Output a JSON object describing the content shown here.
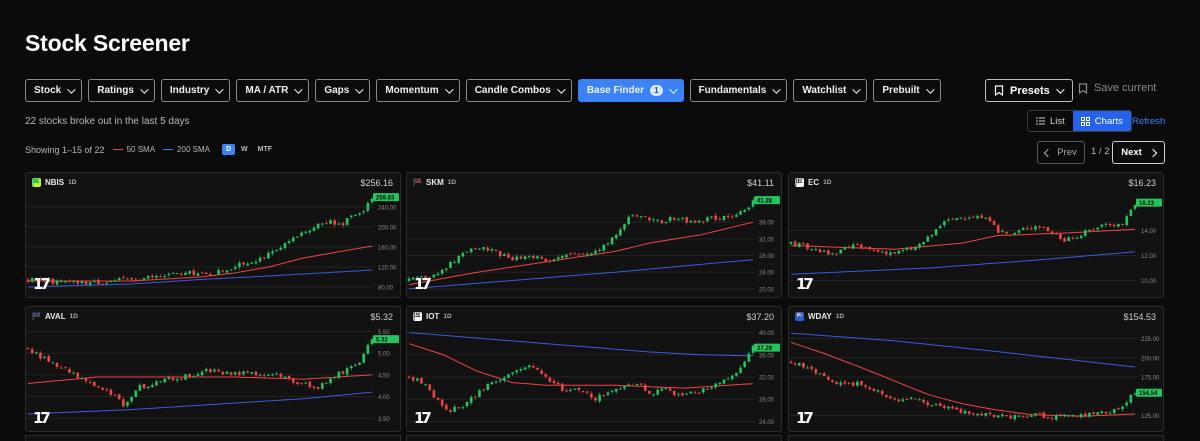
{
  "title": "Stock Screener",
  "filters": [
    {
      "label": "Stock",
      "active": false
    },
    {
      "label": "Ratings",
      "active": false
    },
    {
      "label": "Industry",
      "active": false
    },
    {
      "label": "MA / ATR",
      "active": false
    },
    {
      "label": "Gaps",
      "active": false
    },
    {
      "label": "Momentum",
      "active": false
    },
    {
      "label": "Candle Combos",
      "active": false
    },
    {
      "label": "Base Finder",
      "active": true,
      "badge": "1"
    },
    {
      "label": "Fundamentals",
      "active": false
    },
    {
      "label": "Watchlist",
      "active": false
    },
    {
      "label": "Prebuilt",
      "active": false
    }
  ],
  "presets_label": "Presets",
  "save_current_label": "Save current",
  "summary": "22 stocks broke out in the last 5 days",
  "view_list": "List",
  "view_charts": "Charts",
  "refresh": "Refresh",
  "showing": "Showing 1–15 of 22",
  "legend": [
    {
      "label": "50 SMA",
      "color": "#ef4444"
    },
    {
      "label": "200 SMA",
      "color": "#3b82f6"
    }
  ],
  "timeframes": [
    "D",
    "W",
    "MTF"
  ],
  "timeframe_active": "D",
  "pagination": {
    "prev": "Prev",
    "page": "1 / 2",
    "next": "Next"
  },
  "colors": {
    "up": "#22c55e",
    "down": "#ef4444",
    "accent": "#3b82f6",
    "sma50": "#ef4444",
    "sma200": "#3b5bdb"
  },
  "cards": [
    {
      "ticker": "NBIS",
      "tf": "1D",
      "price": "$256.16",
      "last_label": "259.83",
      "flag": "green",
      "logo": "N",
      "logo_bg": "#c6f432",
      "logo_fg": "#111",
      "ticks": [
        "240.00",
        "200.00",
        "160.00",
        "120.00",
        "80.00"
      ],
      "tick_values": [
        240,
        200,
        160,
        120,
        80
      ],
      "range": [
        68,
        268
      ],
      "last": 259.83,
      "path": [
        [
          0,
          95
        ],
        [
          0.08,
          90
        ],
        [
          0.16,
          88
        ],
        [
          0.24,
          92
        ],
        [
          0.3,
          96
        ],
        [
          0.36,
          100
        ],
        [
          0.42,
          105
        ],
        [
          0.48,
          108
        ],
        [
          0.52,
          104
        ],
        [
          0.56,
          112
        ],
        [
          0.62,
          125
        ],
        [
          0.68,
          140
        ],
        [
          0.72,
          150
        ],
        [
          0.76,
          170
        ],
        [
          0.8,
          190
        ],
        [
          0.84,
          205
        ],
        [
          0.88,
          215
        ],
        [
          0.91,
          200
        ],
        [
          0.94,
          225
        ],
        [
          0.97,
          230
        ],
        [
          1.0,
          259
        ]
      ],
      "sma50": [
        [
          0,
          92
        ],
        [
          0.3,
          92
        ],
        [
          0.5,
          100
        ],
        [
          0.6,
          108
        ],
        [
          0.7,
          120
        ],
        [
          0.8,
          138
        ],
        [
          0.9,
          150
        ],
        [
          1.0,
          162
        ]
      ],
      "sma200": [
        [
          0,
          80
        ],
        [
          0.3,
          86
        ],
        [
          0.5,
          95
        ],
        [
          0.7,
          102
        ],
        [
          0.85,
          108
        ],
        [
          1.0,
          114
        ]
      ]
    },
    {
      "ticker": "SKM",
      "tf": "1D",
      "price": "$41.11",
      "last_label": "41.28",
      "flag": "grey",
      "logo": "SK",
      "logo_bg": "#121212",
      "logo_fg": "#ef4444",
      "ticks": [
        "36.00",
        "32.00",
        "28.00",
        "24.00",
        "20.00"
      ],
      "tick_values": [
        36,
        32,
        28,
        24,
        20
      ],
      "range": [
        19,
        43
      ],
      "last": 41.28,
      "path": [
        [
          0,
          22
        ],
        [
          0.06,
          23
        ],
        [
          0.12,
          26
        ],
        [
          0.16,
          29
        ],
        [
          0.2,
          30
        ],
        [
          0.24,
          29
        ],
        [
          0.3,
          27
        ],
        [
          0.36,
          28
        ],
        [
          0.4,
          27
        ],
        [
          0.46,
          28
        ],
        [
          0.52,
          28.5
        ],
        [
          0.56,
          30
        ],
        [
          0.6,
          33
        ],
        [
          0.64,
          37
        ],
        [
          0.68,
          38
        ],
        [
          0.72,
          36
        ],
        [
          0.78,
          37
        ],
        [
          0.82,
          36
        ],
        [
          0.88,
          37
        ],
        [
          0.92,
          37
        ],
        [
          0.96,
          38
        ],
        [
          1.0,
          41
        ]
      ],
      "sma50": [
        [
          0,
          21
        ],
        [
          0.2,
          24
        ],
        [
          0.4,
          26.5
        ],
        [
          0.6,
          29
        ],
        [
          0.7,
          31
        ],
        [
          0.85,
          33
        ],
        [
          1.0,
          36
        ]
      ],
      "sma200": [
        [
          0,
          20
        ],
        [
          0.3,
          22
        ],
        [
          0.6,
          24
        ],
        [
          0.8,
          25.5
        ],
        [
          1.0,
          27
        ]
      ]
    },
    {
      "ticker": "EC",
      "tf": "1D",
      "price": "$16.23",
      "last_label": "16.23",
      "flag": "grey",
      "logo": "E",
      "logo_bg": "#ffffff",
      "logo_fg": "#111",
      "ticks": [
        "14.00",
        "12.00",
        "10.00"
      ],
      "tick_values": [
        14,
        12,
        10
      ],
      "range": [
        9,
        17
      ],
      "last": 16.23,
      "path": [
        [
          0,
          13
        ],
        [
          0.06,
          12.6
        ],
        [
          0.12,
          12
        ],
        [
          0.18,
          12.8
        ],
        [
          0.24,
          12.4
        ],
        [
          0.3,
          12.2
        ],
        [
          0.36,
          12.6
        ],
        [
          0.4,
          13.4
        ],
        [
          0.44,
          14.6
        ],
        [
          0.48,
          15
        ],
        [
          0.52,
          15.2
        ],
        [
          0.56,
          15
        ],
        [
          0.6,
          14
        ],
        [
          0.64,
          13.6
        ],
        [
          0.68,
          14.2
        ],
        [
          0.72,
          14.4
        ],
        [
          0.76,
          13.8
        ],
        [
          0.8,
          13.2
        ],
        [
          0.84,
          13.6
        ],
        [
          0.88,
          14.2
        ],
        [
          0.92,
          14.6
        ],
        [
          0.96,
          14.4
        ],
        [
          1.0,
          16.2
        ]
      ],
      "sma50": [
        [
          0,
          12.8
        ],
        [
          0.3,
          12.5
        ],
        [
          0.5,
          13
        ],
        [
          0.6,
          13.6
        ],
        [
          0.8,
          13.8
        ],
        [
          1.0,
          14.1
        ]
      ],
      "sma200": [
        [
          0,
          10.5
        ],
        [
          0.4,
          11
        ],
        [
          0.7,
          11.6
        ],
        [
          1.0,
          12.3
        ]
      ]
    },
    {
      "ticker": "AVAL",
      "tf": "1D",
      "price": "$5.32",
      "last_label": "5.32",
      "flag": "grey",
      "logo": "AV",
      "logo_bg": "#121212",
      "logo_fg": "#3b82f6",
      "ticks": [
        "5.50",
        "5.00",
        "4.50",
        "4.00",
        "3.50"
      ],
      "tick_values": [
        5.5,
        5.0,
        4.5,
        4.0,
        3.5
      ],
      "range": [
        3.3,
        5.6
      ],
      "last": 5.32,
      "path": [
        [
          0,
          5.1
        ],
        [
          0.04,
          4.9
        ],
        [
          0.08,
          4.7
        ],
        [
          0.12,
          4.6
        ],
        [
          0.16,
          4.4
        ],
        [
          0.2,
          4.2
        ],
        [
          0.24,
          4.1
        ],
        [
          0.28,
          3.8
        ],
        [
          0.32,
          4.2
        ],
        [
          0.36,
          4.3
        ],
        [
          0.4,
          4.4
        ],
        [
          0.44,
          4.45
        ],
        [
          0.48,
          4.5
        ],
        [
          0.52,
          4.6
        ],
        [
          0.56,
          4.55
        ],
        [
          0.6,
          4.5
        ],
        [
          0.64,
          4.6
        ],
        [
          0.68,
          4.5
        ],
        [
          0.72,
          4.55
        ],
        [
          0.76,
          4.4
        ],
        [
          0.8,
          4.3
        ],
        [
          0.84,
          4.2
        ],
        [
          0.88,
          4.4
        ],
        [
          0.92,
          4.6
        ],
        [
          0.96,
          4.7
        ],
        [
          1.0,
          5.32
        ]
      ],
      "sma50": [
        [
          0,
          4.3
        ],
        [
          0.2,
          4.45
        ],
        [
          0.4,
          4.45
        ],
        [
          0.6,
          4.45
        ],
        [
          0.8,
          4.4
        ],
        [
          1.0,
          4.5
        ]
      ],
      "sma200": [
        [
          0,
          3.6
        ],
        [
          0.3,
          3.7
        ],
        [
          0.6,
          3.85
        ],
        [
          0.8,
          3.95
        ],
        [
          1.0,
          4.1
        ]
      ]
    },
    {
      "ticker": "IOT",
      "tf": "1D",
      "price": "$37.20",
      "last_label": "37.29",
      "flag": "grey",
      "logo": "S",
      "logo_bg": "#ffffff",
      "logo_fg": "#111",
      "ticks": [
        "40.00",
        "36.00",
        "32.00",
        "28.00",
        "24.00"
      ],
      "tick_values": [
        40,
        36,
        32,
        28,
        24
      ],
      "range": [
        23,
        41
      ],
      "last": 37.29,
      "path": [
        [
          0,
          32
        ],
        [
          0.04,
          31
        ],
        [
          0.08,
          28
        ],
        [
          0.12,
          26
        ],
        [
          0.16,
          27
        ],
        [
          0.2,
          29
        ],
        [
          0.24,
          31
        ],
        [
          0.3,
          33
        ],
        [
          0.34,
          34
        ],
        [
          0.38,
          33
        ],
        [
          0.42,
          31
        ],
        [
          0.46,
          29
        ],
        [
          0.5,
          30
        ],
        [
          0.54,
          28
        ],
        [
          0.58,
          29
        ],
        [
          0.62,
          30
        ],
        [
          0.66,
          31
        ],
        [
          0.7,
          29
        ],
        [
          0.74,
          30
        ],
        [
          0.78,
          28.5
        ],
        [
          0.82,
          29
        ],
        [
          0.86,
          30
        ],
        [
          0.9,
          31
        ],
        [
          0.94,
          32
        ],
        [
          1.0,
          37.3
        ]
      ],
      "sma50": [
        [
          0,
          38
        ],
        [
          0.1,
          36
        ],
        [
          0.2,
          33
        ],
        [
          0.3,
          31
        ],
        [
          0.4,
          30.5
        ],
        [
          0.6,
          30.5
        ],
        [
          0.8,
          30
        ],
        [
          1.0,
          30.8
        ]
      ],
      "sma200": [
        [
          0,
          40
        ],
        [
          0.3,
          38.5
        ],
        [
          0.5,
          37.5
        ],
        [
          0.7,
          36.5
        ],
        [
          0.85,
          36
        ],
        [
          1.0,
          35.8
        ]
      ]
    },
    {
      "ticker": "WDAY",
      "tf": "1D",
      "price": "$154.53",
      "last_label": "154.54",
      "flag": "grey",
      "logo": "W",
      "logo_bg": "#2563eb",
      "logo_fg": "#fff",
      "ticks": [
        "225.00",
        "200.00",
        "175.00",
        "125.00"
      ],
      "tick_values": [
        225,
        200,
        175,
        125
      ],
      "range": [
        110,
        240
      ],
      "last": 154.54,
      "path": [
        [
          0,
          195
        ],
        [
          0.04,
          188
        ],
        [
          0.08,
          178
        ],
        [
          0.12,
          170
        ],
        [
          0.16,
          165
        ],
        [
          0.2,
          168
        ],
        [
          0.24,
          160
        ],
        [
          0.28,
          150
        ],
        [
          0.32,
          145
        ],
        [
          0.36,
          148
        ],
        [
          0.4,
          140
        ],
        [
          0.44,
          135
        ],
        [
          0.48,
          132
        ],
        [
          0.52,
          128
        ],
        [
          0.56,
          126
        ],
        [
          0.6,
          124
        ],
        [
          0.64,
          122
        ],
        [
          0.68,
          124
        ],
        [
          0.72,
          126
        ],
        [
          0.76,
          123
        ],
        [
          0.8,
          125
        ],
        [
          0.84,
          124
        ],
        [
          0.88,
          127
        ],
        [
          0.92,
          130
        ],
        [
          0.96,
          135
        ],
        [
          1.0,
          155
        ]
      ],
      "sma50": [
        [
          0,
          220
        ],
        [
          0.1,
          205
        ],
        [
          0.2,
          188
        ],
        [
          0.3,
          170
        ],
        [
          0.4,
          152
        ],
        [
          0.5,
          140
        ],
        [
          0.6,
          132
        ],
        [
          0.7,
          126
        ],
        [
          0.85,
          124
        ],
        [
          1.0,
          127
        ]
      ],
      "sma200": [
        [
          0,
          232
        ],
        [
          0.3,
          222
        ],
        [
          0.6,
          208
        ],
        [
          0.8,
          198
        ],
        [
          1.0,
          188
        ]
      ]
    }
  ]
}
